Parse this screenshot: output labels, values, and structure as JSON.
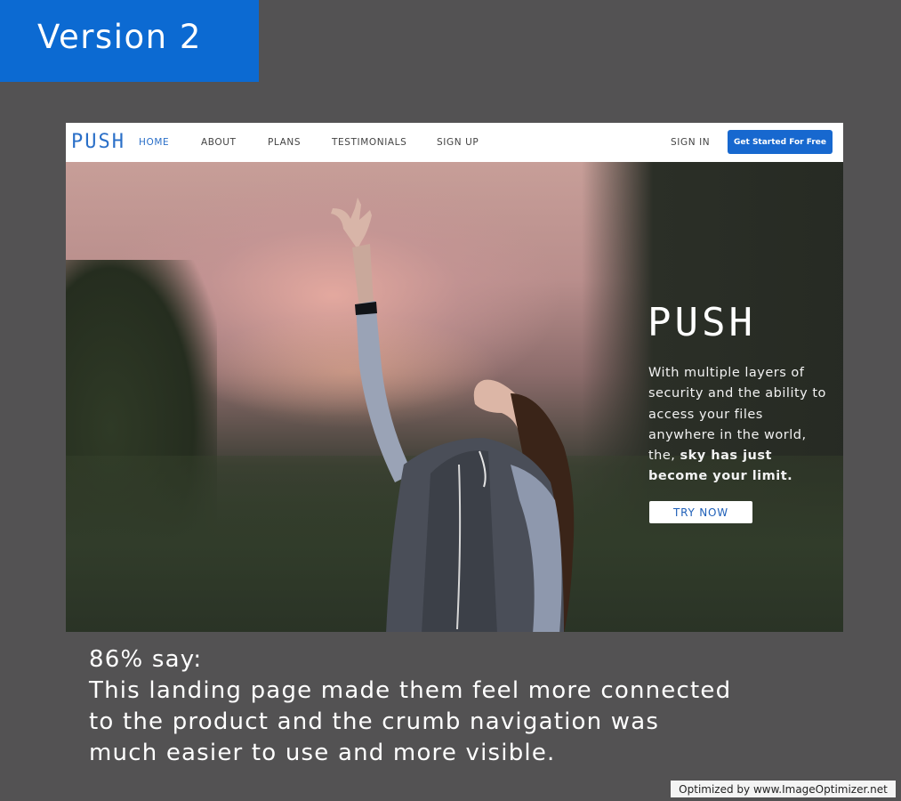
{
  "badge": {
    "label": "Version 2",
    "color": "#0c6ad2"
  },
  "site": {
    "logo": "PUSH",
    "nav": [
      {
        "label": "HOME",
        "active": true
      },
      {
        "label": "ABOUT",
        "active": false
      },
      {
        "label": "PLANS",
        "active": false
      },
      {
        "label": "TESTIMONIALS",
        "active": false
      },
      {
        "label": "SIGN UP",
        "active": false
      }
    ],
    "sign_in": "SIGN IN",
    "cta": "Get Started For Free",
    "accent": "#1768cf"
  },
  "hero": {
    "logo": "PUSH",
    "copy_plain": "With multiple layers of security and the ability to access your files anywhere in the world, the,",
    "copy_bold": "sky has just become your limit.",
    "button": "TRY NOW"
  },
  "caption": {
    "line1": "86% say:",
    "line2": "This landing page made them feel more connected",
    "line3": "to the product and the crumb navigation was",
    "line4": "much easier to use and more visible."
  },
  "watermark": "Optimized by www.ImageOptimizer.net"
}
